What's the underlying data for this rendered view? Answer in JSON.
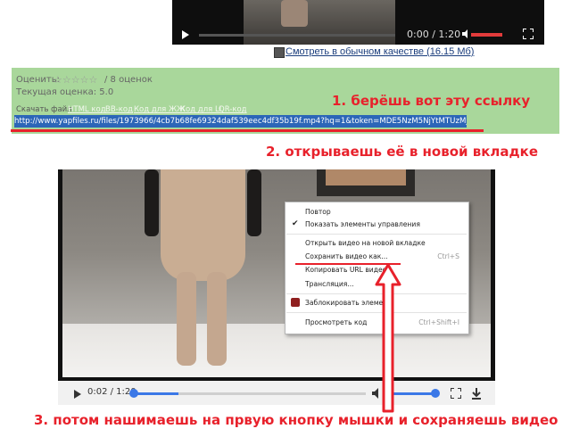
{
  "top_player": {
    "time": "0:00 / 1:20",
    "quality_link": "Смотреть в обычном качестве (16.15 Мб)"
  },
  "rating": {
    "rate_label": "Оценить:",
    "stars": "☆☆☆☆☆",
    "votes": "/ 8 оценок",
    "current": "Текущая оценка: 5.0"
  },
  "code_links": {
    "download": "Скачать файл",
    "html": "HTML код",
    "bb": "BB-код",
    "ok": "Код для ЖЖ",
    "li": "Код для LI",
    "qr": "QR-код"
  },
  "url_field": {
    "value": "http://www.yapfiles.ru/files/1973966/4cb7b68fe69324daf539eec4df35b19f.mp4?hq=1&token=MDE5NzM5NjYtMTUzMjQ0MDg3Mw"
  },
  "annotations": {
    "step1": "1.  берёшь вот эту ссылку",
    "step2": "2.  открываешь её в новой вкладке",
    "step3": "3.  потом нашимаешь на првую кнопку мышки и сохраняешь видео"
  },
  "player": {
    "time": "0:02 / 1:20",
    "progress": 0.025,
    "volume": 1.0
  },
  "context_menu": {
    "items": [
      {
        "label": "Повтор",
        "shortcut": "",
        "checked": false
      },
      {
        "label": "Показать элементы управления",
        "shortcut": "",
        "checked": true
      },
      {
        "label": "Открыть видео на новой вкладке",
        "shortcut": "",
        "checked": false
      },
      {
        "label": "Сохранить видео как...",
        "shortcut": "Ctrl+S",
        "checked": false
      },
      {
        "label": "Копировать URL видео",
        "shortcut": "",
        "checked": false
      },
      {
        "label": "Трансляция...",
        "shortcut": "",
        "checked": false
      },
      {
        "label": "Заблокировать элемент",
        "shortcut": "",
        "checked": false
      },
      {
        "label": "Просмотреть код",
        "shortcut": "Ctrl+Shift+I",
        "checked": false
      }
    ]
  },
  "colors": {
    "accent_red": "#e8212b",
    "panel_green": "#a9d79b",
    "selection_blue": "#2c66b8",
    "player_blue": "#3b78e7"
  },
  "icons": {
    "play": "play-icon",
    "volume": "volume-icon",
    "fullscreen": "fullscreen-icon",
    "download": "download-icon",
    "film": "film-icon",
    "ublock": "ublock-icon",
    "check": "checkmark-icon",
    "arrow": "arrow-up-icon"
  }
}
